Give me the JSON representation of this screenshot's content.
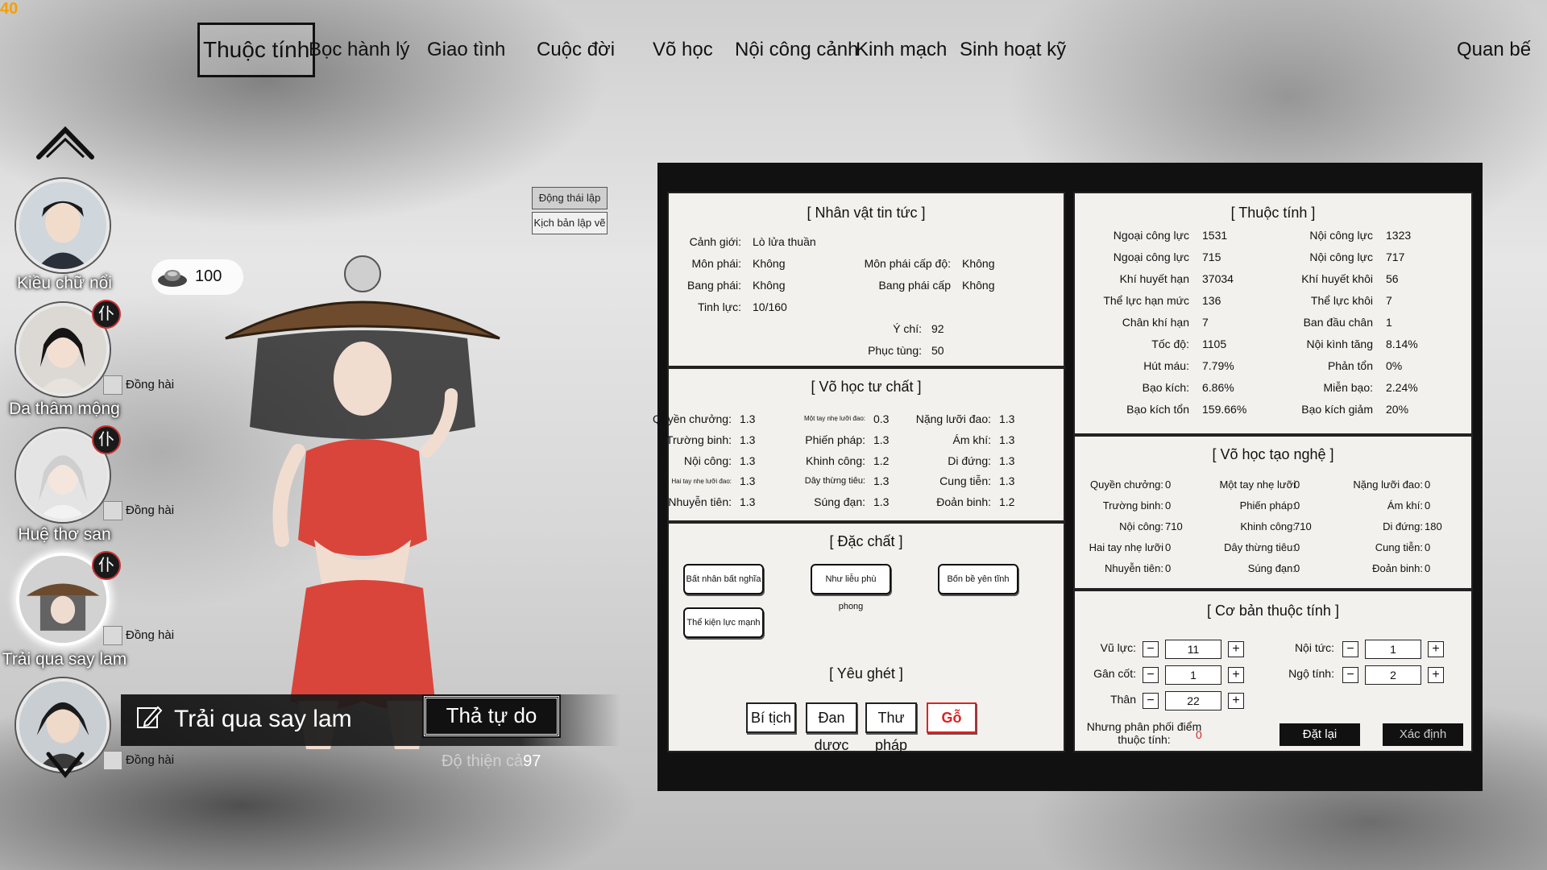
{
  "fps": "40",
  "nav": {
    "tabs": [
      "Thuộc tính",
      "Bọc hành lý",
      "Giao tình",
      "Cuộc đời",
      "Võ học",
      "Nội công cảnh",
      "Kinh mạch",
      "Sinh hoạt kỹ"
    ],
    "right": "Quan bế"
  },
  "characters": [
    {
      "name": "Kiều chữ nổi"
    },
    {
      "name": "Da thâm mộng",
      "badge": "仆",
      "dong_hai": "Đồng hài"
    },
    {
      "name": "Huệ thơ san",
      "badge": "仆",
      "dong_hai": "Đồng hài"
    },
    {
      "name": "Trải qua say lam",
      "badge": "仆",
      "dong_hai": "Đồng hài"
    },
    {
      "dong_hai": "Đồng hài"
    }
  ],
  "coin": {
    "value": "100"
  },
  "side_buttons": [
    "Động thái lập vẽ",
    "Kịch bản lập vẽ"
  ],
  "selected": {
    "name": "Trải qua say lam",
    "free_button": "Thả tự do",
    "affection_label": "Độ thiện cả",
    "affection_value": "97"
  },
  "info": {
    "title": "[ Nhân vật tin tức ]",
    "left": [
      {
        "label": "Cảnh giới:",
        "value": "Lò lửa thuần"
      },
      {
        "label": "Môn phái:",
        "value": "Không"
      },
      {
        "label": "Bang phái:",
        "value": "Không"
      },
      {
        "label": "Tinh lực:",
        "value": "10/160"
      }
    ],
    "right": [
      {
        "label": "Môn phái cấp độ:",
        "value": "Không"
      },
      {
        "label": "Bang phái cấp",
        "value": "Không"
      },
      {
        "label": "Ý chí:",
        "value": "92"
      },
      {
        "label": "Phục tùng:",
        "value": "50"
      }
    ]
  },
  "aptitude": {
    "title": "[ Võ học tư chất ]",
    "col1": [
      {
        "label": "Quyền chưởng:",
        "value": "1.3"
      },
      {
        "label": "Trường binh:",
        "value": "1.3"
      },
      {
        "label": "Nội công:",
        "value": "1.3"
      },
      {
        "label": "Hai tay nhẹ lưỡi đao:",
        "value": "1.3"
      },
      {
        "label": "Nhuyễn tiên:",
        "value": "1.3"
      }
    ],
    "col2": [
      {
        "label": "Một tay nhẹ lưỡi đao:",
        "value": "0.3"
      },
      {
        "label": "Phiến pháp:",
        "value": "1.3"
      },
      {
        "label": "Khinh công:",
        "value": "1.2"
      },
      {
        "label": "Dây thừng tiêu:",
        "value": "1.3"
      },
      {
        "label": "Súng đạn:",
        "value": "1.3"
      }
    ],
    "col3": [
      {
        "label": "Nặng lưỡi đao:",
        "value": "1.3"
      },
      {
        "label": "Ám khí:",
        "value": "1.3"
      },
      {
        "label": "Di đứng:",
        "value": "1.3"
      },
      {
        "label": "Cung tiễn:",
        "value": "1.3"
      },
      {
        "label": "Đoản binh:",
        "value": "1.2"
      }
    ]
  },
  "traits": {
    "title": "[ Đặc chất ]",
    "items": [
      "Bất nhân bất nghĩa",
      "Như liễu phù phong",
      "Bốn bề yên tĩnh",
      "Thể kiện lực mạnh"
    ]
  },
  "likes": {
    "title": "[ Yêu ghét ]",
    "items": [
      "Bí tịch",
      "Đan dược",
      "Thư pháp",
      "Gỗ"
    ]
  },
  "attributes": {
    "title": "[ Thuộc tính ]",
    "left": [
      {
        "label": "Ngoại công lực",
        "value": "1531"
      },
      {
        "label": "Ngoại công lực",
        "value": "715"
      },
      {
        "label": "Khí huyết hạn",
        "value": "37034"
      },
      {
        "label": "Thể lực hạn mức",
        "value": "136"
      },
      {
        "label": "Chân khí hạn",
        "value": "7"
      },
      {
        "label": "Tốc độ:",
        "value": "1105"
      },
      {
        "label": "Hút máu:",
        "value": "7.79%"
      },
      {
        "label": "Bạo kích:",
        "value": "6.86%"
      },
      {
        "label": "Bạo kích tổn",
        "value": "159.66%"
      }
    ],
    "right": [
      {
        "label": "Nội công lực",
        "value": "1323"
      },
      {
        "label": "Nội công lực",
        "value": "717"
      },
      {
        "label": "Khí huyết khôi",
        "value": "56"
      },
      {
        "label": "Thể lực khôi",
        "value": "7"
      },
      {
        "label": "Ban đầu chân",
        "value": "1"
      },
      {
        "label": "Nội kình tăng",
        "value": "8.14%"
      },
      {
        "label": "Phản tổn",
        "value": "0%"
      },
      {
        "label": "Miễn bạo:",
        "value": "2.24%"
      },
      {
        "label": "Bạo kích giảm",
        "value": "20%"
      }
    ]
  },
  "skills": {
    "title": "[ Võ học tạo nghệ ]",
    "col1": [
      {
        "label": "Quyền chưởng:",
        "value": "0"
      },
      {
        "label": "Trường binh:",
        "value": "0"
      },
      {
        "label": "Nội công:",
        "value": "710"
      },
      {
        "label": "Hai tay nhẹ lưỡi",
        "value": "0"
      },
      {
        "label": "Nhuyễn tiên:",
        "value": "0"
      }
    ],
    "col2": [
      {
        "label": "Một tay nhẹ lưỡi",
        "value": "0"
      },
      {
        "label": "Phiến pháp:",
        "value": "0"
      },
      {
        "label": "Khinh công:",
        "value": "710"
      },
      {
        "label": "Dây thừng tiêu:",
        "value": "0"
      },
      {
        "label": "Súng đạn:",
        "value": "0"
      }
    ],
    "col3": [
      {
        "label": "Nặng lưỡi đao:",
        "value": "0"
      },
      {
        "label": "Ám khí:",
        "value": "0"
      },
      {
        "label": "Di đứng:",
        "value": "180"
      },
      {
        "label": "Cung tiễn:",
        "value": "0"
      },
      {
        "label": "Đoản binh:",
        "value": "0"
      }
    ]
  },
  "base": {
    "title": "[ Cơ bản thuộc tính ]",
    "left": [
      {
        "label": "Vũ lực:",
        "value": "11"
      },
      {
        "label": "Gân cốt:",
        "value": "1"
      },
      {
        "label": "Thân",
        "value": "22"
      }
    ],
    "right": [
      {
        "label": "Nội tức:",
        "value": "1"
      },
      {
        "label": "Ngộ tính:",
        "value": "2"
      }
    ],
    "alloc_label_1": "Nhưng phân phối điểm",
    "alloc_label_2": "thuộc tính:",
    "alloc_value": "0",
    "reset": "Đặt lại",
    "confirm": "Xác định"
  },
  "colors": {
    "accent_red": "#d22222",
    "panel_bg": "#f2f1ee",
    "panel_border": "#111111"
  }
}
